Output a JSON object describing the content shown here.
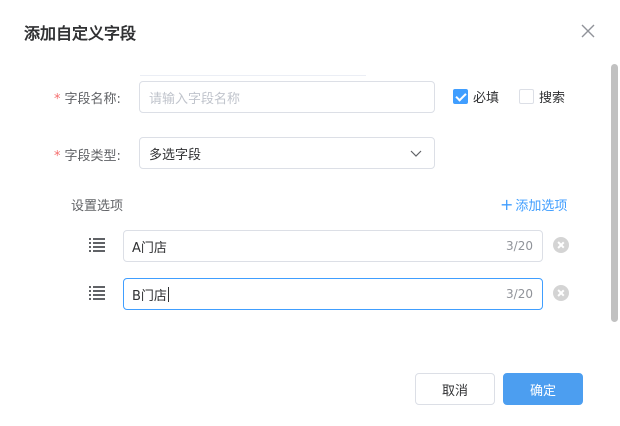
{
  "dialog": {
    "title": "添加自定义字段",
    "close_icon": "close-icon"
  },
  "form": {
    "field_name": {
      "label": "字段名称:",
      "required_mark": "*",
      "placeholder": "请输入字段名称",
      "value": ""
    },
    "required_checkbox": {
      "label": "必填",
      "checked": true
    },
    "search_checkbox": {
      "label": "搜索",
      "checked": false
    },
    "field_type": {
      "label": "字段类型:",
      "required_mark": "*",
      "selected": "多选字段",
      "icon": "chevron-down-icon"
    },
    "options_section": {
      "label": "设置选项",
      "add_label": "添加选项",
      "add_icon": "plus-icon"
    },
    "options": [
      {
        "value": "A门店",
        "count": "3/20",
        "focused": false
      },
      {
        "value": "B门店",
        "count": "3/20",
        "focused": true
      }
    ]
  },
  "footer": {
    "cancel_label": "取消",
    "confirm_label": "确定"
  },
  "colors": {
    "primary": "#409eff",
    "confirm_button": "#4c9ef0",
    "required_mark": "#f56c6c",
    "border": "#dcdfe6"
  }
}
